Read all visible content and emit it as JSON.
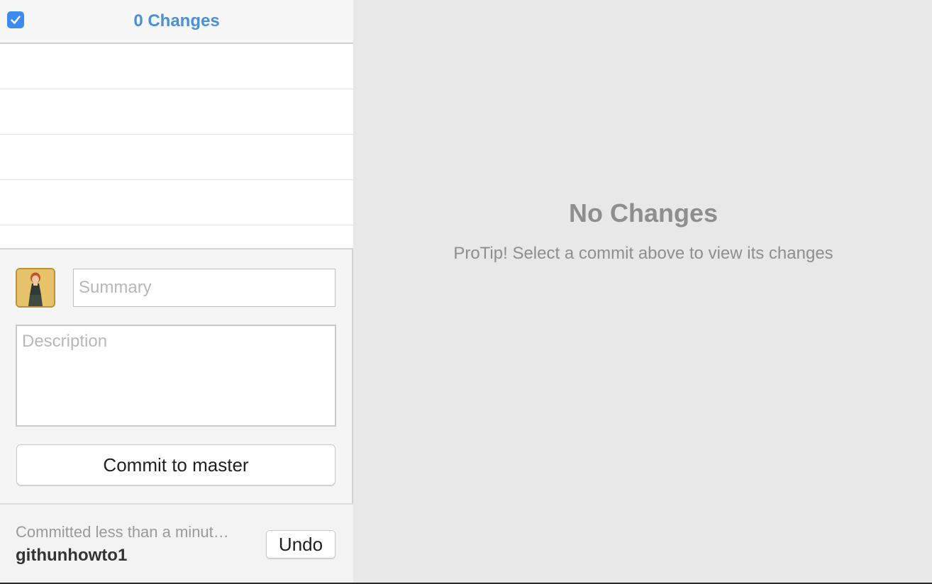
{
  "header": {
    "select_all_checked": true,
    "title": "0 Changes",
    "accent_color": "#3d8bec"
  },
  "file_list": {
    "rows": [
      "",
      "",
      "",
      "",
      ""
    ]
  },
  "commit_form": {
    "summary_placeholder": "Summary",
    "summary_value": "",
    "description_placeholder": "Description",
    "description_value": "",
    "commit_button_label": "Commit to master"
  },
  "undo": {
    "meta": "Committed less than a minut…",
    "commit_name": "githunhowto1",
    "undo_label": "Undo"
  },
  "detail_pane": {
    "title": "No Changes",
    "tip": "ProTip! Select a commit above to view its changes"
  },
  "icons": {
    "checkbox": "checkmark-icon",
    "avatar": "user-avatar"
  }
}
